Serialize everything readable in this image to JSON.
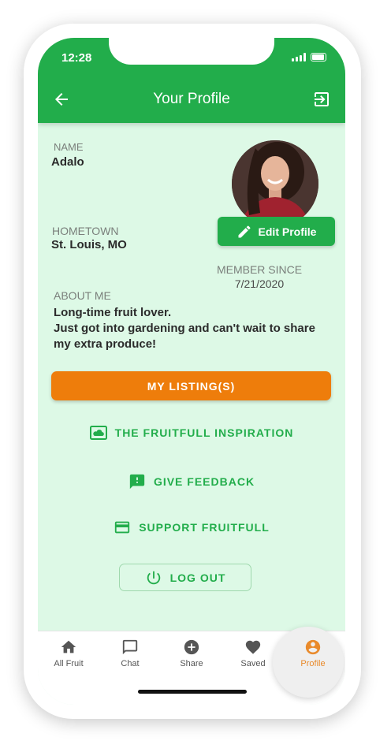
{
  "status_bar": {
    "time": "12:28"
  },
  "header": {
    "title": "Your Profile"
  },
  "profile": {
    "name_label": "NAME",
    "name": "Adalo",
    "hometown_label": "HOMETOWN",
    "hometown": "St. Louis, MO",
    "edit_button": "Edit Profile",
    "member_since_label": "MEMBER SINCE",
    "member_since": "7/21/2020",
    "about_label": "ABOUT ME",
    "about_lines": [
      "Long-time fruit lover.",
      "Just got into gardening and can't wait to share",
      "my extra produce!"
    ]
  },
  "actions": {
    "my_listings": "MY LISTING(S)",
    "inspiration": "THE FRUITFULL INSPIRATION",
    "feedback": "GIVE FEEDBACK",
    "support": "SUPPORT FRUITFULL",
    "logout": "LOG OUT"
  },
  "tabbar": {
    "items": [
      {
        "label": "All Fruit",
        "icon": "home-icon"
      },
      {
        "label": "Chat",
        "icon": "chat-icon"
      },
      {
        "label": "Share",
        "icon": "plus-circle-icon"
      },
      {
        "label": "Saved",
        "icon": "heart-icon"
      },
      {
        "label": "Profile",
        "icon": "account-circle-icon"
      }
    ],
    "active": "Profile"
  },
  "colors": {
    "primary_green": "#22ad4b",
    "background_mint": "#ddf9e6",
    "accent_orange": "#ee7d0b",
    "active_tab": "#e98a2b"
  }
}
